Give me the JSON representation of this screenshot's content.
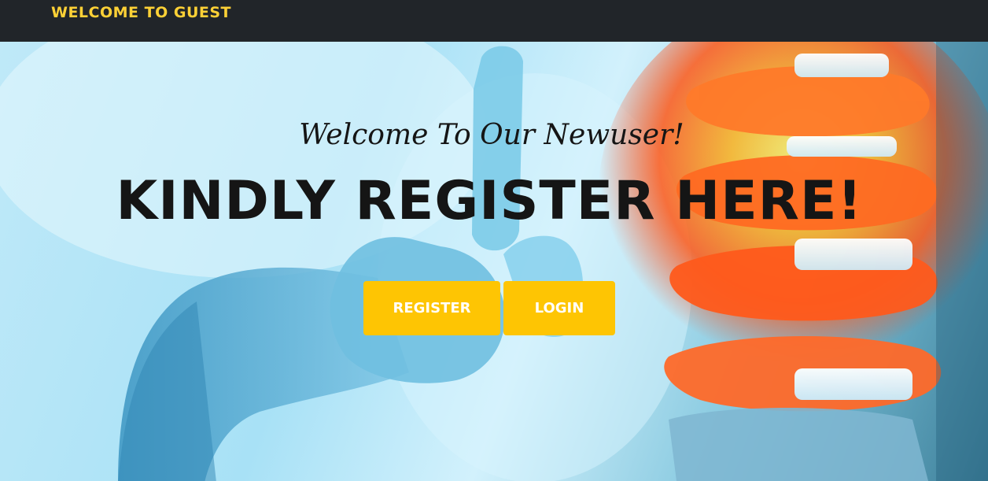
{
  "navbar": {
    "brand": "WELCOME TO GUEST"
  },
  "hero": {
    "subheading": "Welcome To Our Newuser!",
    "heading": "KINDLY REGISTER HERE!",
    "buttons": {
      "register": "REGISTER",
      "login": "LOGIN"
    }
  },
  "colors": {
    "navbar_bg": "#212529",
    "brand_accent": "#fed136",
    "button_bg": "#fec503",
    "button_text": "#ffffff",
    "heading_text": "#151515"
  },
  "images": {
    "hero_background": "medical-spine-illustration"
  }
}
